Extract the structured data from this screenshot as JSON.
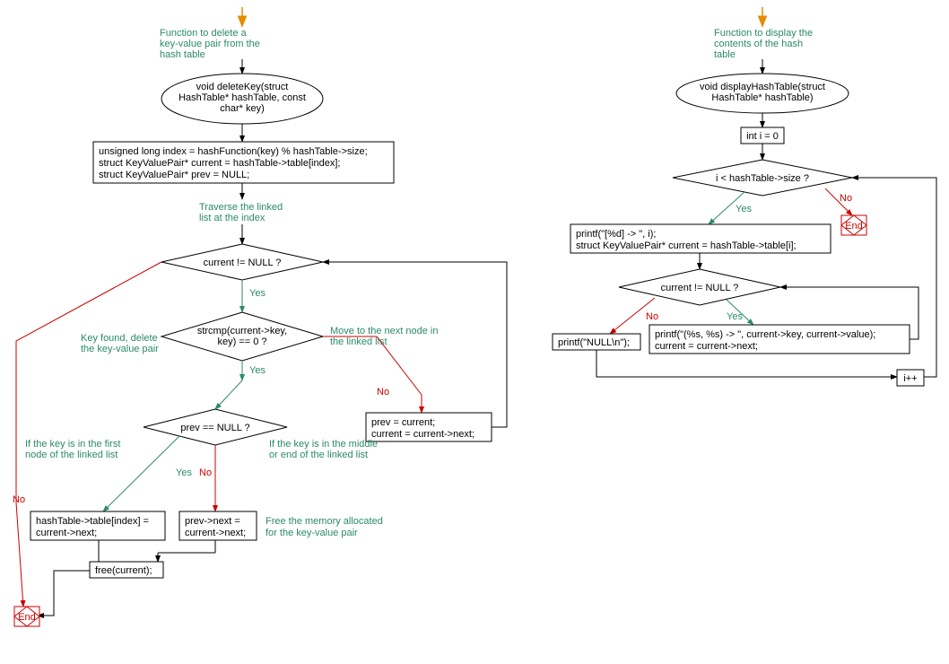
{
  "chart_data": [
    {
      "type": "flowchart",
      "title": "deleteKey",
      "nodes": [
        {
          "id": "c1",
          "kind": "comment",
          "text": "Function to delete a key-value pair from the hash table"
        },
        {
          "id": "start",
          "kind": "terminal",
          "text": "void deleteKey(struct HashTable* hashTable, const char* key)"
        },
        {
          "id": "p1",
          "kind": "process",
          "text": "unsigned long index = hashFunction(key) % hashTable->size;\nstruct KeyValuePair* current = hashTable->table[index];\nstruct KeyValuePair* prev = NULL;"
        },
        {
          "id": "c2",
          "kind": "comment",
          "text": "Traverse the linked list at the index"
        },
        {
          "id": "d1",
          "kind": "decision",
          "text": "current != NULL ?"
        },
        {
          "id": "d2",
          "kind": "decision",
          "text": "strcmp(current->key, key) == 0 ?"
        },
        {
          "id": "c3",
          "kind": "comment",
          "text": "Key found, delete the key-value pair"
        },
        {
          "id": "c4",
          "kind": "comment",
          "text": "Move to the next node in the linked list"
        },
        {
          "id": "p2",
          "kind": "process",
          "text": "prev = current;\ncurrent = current->next;"
        },
        {
          "id": "d3",
          "kind": "decision",
          "text": "prev == NULL ?"
        },
        {
          "id": "c5",
          "kind": "comment",
          "text": "If the key is in the first node of the linked list"
        },
        {
          "id": "c6",
          "kind": "comment",
          "text": "If the key is in the middle or end of the linked list"
        },
        {
          "id": "p3",
          "kind": "process",
          "text": "hashTable->table[index] = current->next;"
        },
        {
          "id": "p4",
          "kind": "process",
          "text": "prev->next = current->next;"
        },
        {
          "id": "c7",
          "kind": "comment",
          "text": "Free the memory allocated for the key-value pair"
        },
        {
          "id": "p5",
          "kind": "process",
          "text": "free(current);"
        },
        {
          "id": "end",
          "kind": "end",
          "text": "End"
        }
      ],
      "edges": [
        {
          "from": "start",
          "to": "p1"
        },
        {
          "from": "p1",
          "to": "d1"
        },
        {
          "from": "d1",
          "to": "d2",
          "label": "Yes"
        },
        {
          "from": "d1",
          "to": "end",
          "label": "No"
        },
        {
          "from": "d2",
          "to": "d3",
          "label": "Yes"
        },
        {
          "from": "d2",
          "to": "p2",
          "label": "No"
        },
        {
          "from": "p2",
          "to": "d1"
        },
        {
          "from": "d3",
          "to": "p3",
          "label": "Yes"
        },
        {
          "from": "d3",
          "to": "p4",
          "label": "No"
        },
        {
          "from": "p3",
          "to": "p5"
        },
        {
          "from": "p4",
          "to": "p5"
        },
        {
          "from": "p5",
          "to": "end"
        }
      ]
    },
    {
      "type": "flowchart",
      "title": "displayHashTable",
      "nodes": [
        {
          "id": "c1",
          "kind": "comment",
          "text": "Function to display the contents of the hash table"
        },
        {
          "id": "start",
          "kind": "terminal",
          "text": "void displayHashTable(struct HashTable* hashTable)"
        },
        {
          "id": "p1",
          "kind": "process",
          "text": "int i = 0"
        },
        {
          "id": "d1",
          "kind": "decision",
          "text": "i < hashTable->size ?"
        },
        {
          "id": "p2",
          "kind": "process",
          "text": "printf(\"[%d] -> \", i);\nstruct KeyValuePair* current = hashTable->table[i];"
        },
        {
          "id": "d2",
          "kind": "decision",
          "text": "current != NULL ?"
        },
        {
          "id": "p3",
          "kind": "process",
          "text": "printf(\"(%s, %s) -> \", current->key, current->value);\ncurrent = current->next;"
        },
        {
          "id": "p4",
          "kind": "process",
          "text": "printf(\"NULL\\n\");"
        },
        {
          "id": "p5",
          "kind": "process",
          "text": "i++"
        },
        {
          "id": "end",
          "kind": "end",
          "text": "End"
        }
      ],
      "edges": [
        {
          "from": "start",
          "to": "p1"
        },
        {
          "from": "p1",
          "to": "d1"
        },
        {
          "from": "d1",
          "to": "p2",
          "label": "Yes"
        },
        {
          "from": "d1",
          "to": "end",
          "label": "No"
        },
        {
          "from": "p2",
          "to": "d2"
        },
        {
          "from": "d2",
          "to": "p3",
          "label": "Yes"
        },
        {
          "from": "d2",
          "to": "p4",
          "label": "No"
        },
        {
          "from": "p3",
          "to": "d2"
        },
        {
          "from": "p4",
          "to": "p5"
        },
        {
          "from": "p5",
          "to": "d1"
        }
      ]
    }
  ],
  "left": {
    "comment1_l1": "Function to delete a",
    "comment1_l2": "key-value pair from the",
    "comment1_l3": "hash table",
    "start_l1": "void deleteKey(struct",
    "start_l2": "HashTable* hashTable, const",
    "start_l3": "char* key)",
    "p1_l1": "unsigned long index = hashFunction(key) % hashTable->size;",
    "p1_l2": "struct KeyValuePair* current = hashTable->table[index];",
    "p1_l3": "struct KeyValuePair* prev = NULL;",
    "comment2_l1": "Traverse the linked",
    "comment2_l2": "list at the index",
    "d1": "current != NULL ?",
    "d2_l1": "strcmp(current->key,",
    "d2_l2": "key) == 0 ?",
    "comment3_l1": "Key found, delete",
    "comment3_l2": "the key-value pair",
    "comment4_l1": "Move to the next node in",
    "comment4_l2": "the linked list",
    "p2_l1": "prev = current;",
    "p2_l2": "current = current->next;",
    "d3": "prev == NULL ?",
    "comment5_l1": "If the key is in the first",
    "comment5_l2": "node of the linked list",
    "comment6_l1": "If the key is in the middle",
    "comment6_l2": "or end of the linked list",
    "p3_l1": "hashTable->table[index] =",
    "p3_l2": "current->next;",
    "p4_l1": "prev->next =",
    "p4_l2": "current->next;",
    "comment7_l1": "Free the memory allocated",
    "comment7_l2": "for the key-value pair",
    "p5": "free(current);",
    "end": "End",
    "yes": "Yes",
    "no": "No"
  },
  "right": {
    "comment1_l1": "Function to display the",
    "comment1_l2": "contents of the hash",
    "comment1_l3": "table",
    "start_l1": "void displayHashTable(struct",
    "start_l2": "HashTable* hashTable)",
    "p1": "int i = 0",
    "d1": "i < hashTable->size ?",
    "p2_l1": "printf(\"[%d] -> \", i);",
    "p2_l2": "struct KeyValuePair* current = hashTable->table[i];",
    "d2": "current != NULL ?",
    "p3_l1": "printf(\"(%s, %s) -> \", current->key, current->value);",
    "p3_l2": "current = current->next;",
    "p4": "printf(\"NULL\\n\");",
    "p5": "i++",
    "end": "End",
    "yes": "Yes",
    "no": "No"
  }
}
